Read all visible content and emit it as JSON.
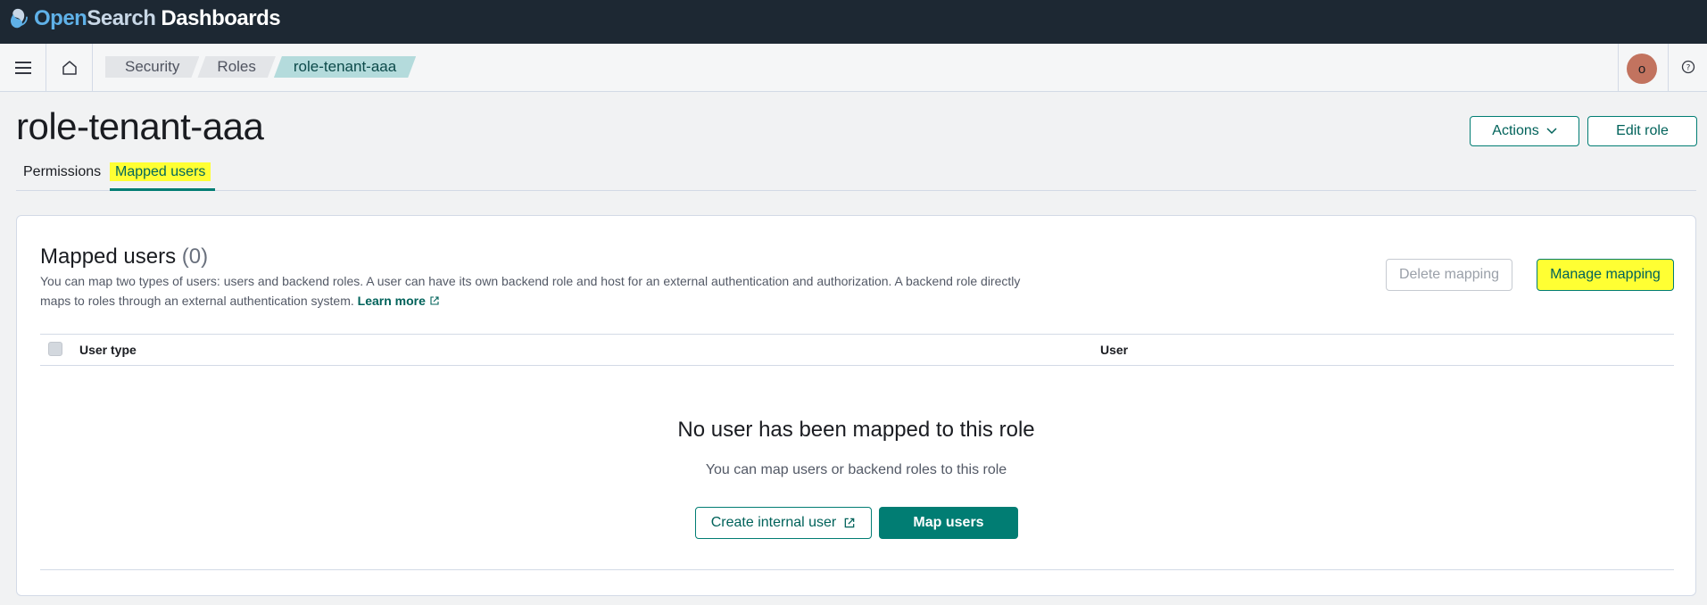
{
  "header": {
    "logo": {
      "open": "Open",
      "search": "Search",
      "dashboards": "Dashboards"
    }
  },
  "breadcrumbs": [
    {
      "label": "Security"
    },
    {
      "label": "Roles"
    },
    {
      "label": "role-tenant-aaa"
    }
  ],
  "user": {
    "avatar_initial": "o"
  },
  "page": {
    "title": "role-tenant-aaa",
    "actions_label": "Actions",
    "edit_label": "Edit role",
    "tabs": [
      {
        "label": "Permissions",
        "selected": false
      },
      {
        "label": "Mapped users",
        "selected": true
      }
    ]
  },
  "panel": {
    "title": "Mapped users",
    "count": "(0)",
    "description": "You can map two types of users: users and backend roles. A user can have its own backend role and host for an external authentication and authorization. A backend role directly maps to roles through an external authentication system.",
    "learn_more": "Learn more",
    "delete_label": "Delete mapping",
    "manage_label": "Manage mapping",
    "columns": [
      "User type",
      "User"
    ],
    "empty_title": "No user has been mapped to this role",
    "empty_subtitle": "You can map users or backend roles to this role",
    "create_user_label": "Create internal user",
    "map_users_label": "Map users"
  },
  "colors": {
    "header_bg": "#1d2833",
    "accent": "#017d73",
    "highlight": "#ffff33",
    "active_crumb": "#b4dbdc",
    "avatar": "#c2735f"
  }
}
